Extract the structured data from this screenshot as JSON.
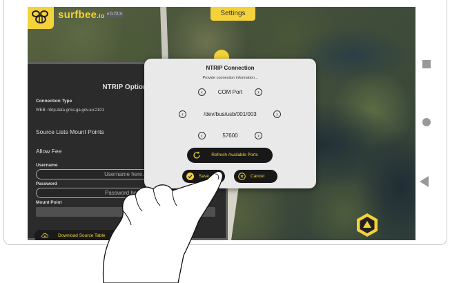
{
  "header": {
    "brand": "surfbee",
    "brand_suffix": ".io",
    "version": "v 0.72.3",
    "settings_label": "Settings"
  },
  "options_panel": {
    "title": "NTRIP Options",
    "connection_type_label": "Connection Type",
    "connection_type_value": "WEB: ntrip.data.gnss.ga.gov.au:2101",
    "source_lists_label": "Source Lists Mount Points",
    "allow_fee_label": "Allow Fee",
    "username_label": "Username",
    "username_placeholder": "Username here...",
    "password_label": "Password",
    "password_placeholder": "Password here...",
    "mount_point_label": "Mount Point",
    "download_label": "Download Source Table"
  },
  "modal": {
    "title": "NTRIP Connection",
    "subtitle": "Provide connection information...",
    "port_type": "COM Port",
    "device_path": "/dev/bus/usb/001/003",
    "baud_rate": "57600",
    "refresh_label": "Refresh Available Ports",
    "save_label": "Save",
    "cancel_label": "Cancel"
  },
  "colors": {
    "accent": "#f3d23a",
    "dark_button": "#181818",
    "modal_bg": "#e9e9e9"
  },
  "icons": {
    "logo": "bee-icon",
    "prev": "chevron-left-icon",
    "next": "chevron-right-icon",
    "refresh": "refresh-icon",
    "save": "check-icon",
    "cancel": "close-icon",
    "download": "cloud-download-icon",
    "nav": "navigation-arrow-icon"
  }
}
